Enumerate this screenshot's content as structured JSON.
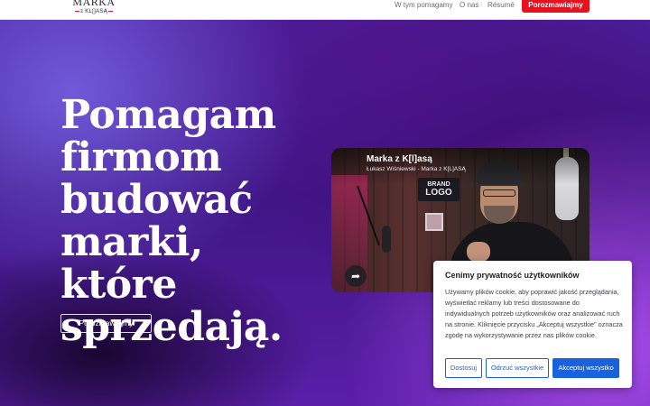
{
  "brand": {
    "logo_main": "MARKA",
    "logo_sub": "z KL[]ASĄ"
  },
  "nav": {
    "links": [
      "W tym pomagamy",
      "O nas",
      "Résumé"
    ],
    "cta_label": "Porozmawiajmy",
    "cta_color": "#e5131f"
  },
  "hero": {
    "headline_lines": [
      "Pomagam",
      "firmom",
      "budować",
      "marki, które",
      "sprzedają."
    ],
    "button_label": "Porozmawiajmy"
  },
  "video": {
    "title": "Marka z K[l]asą",
    "subtitle": "Łukasz Wiśniewski - Marka z K[L]ASĄ",
    "sign_line1": "BRAND",
    "sign_line2": "LOGO",
    "share_icon": "share-icon"
  },
  "cookie_banner": {
    "title": "Cenimy prywatność użytkowników",
    "text": "Używamy plików cookie, aby poprawić jakość przeglądania, wyświetlać reklamy lub treści dostosowane do indywidualnych potrzeb użytkowników oraz analizować ruch na stronie. Kliknięcie przycisku „Akceptuj wszystkie\" oznacza zgodę na wykorzystywanie przez nas plików cookie.",
    "customize_label": "Dostosuj",
    "reject_label": "Odrzuć wszystkie",
    "accept_label": "Akceptuj wszystko",
    "accent_color": "#1863dc"
  }
}
